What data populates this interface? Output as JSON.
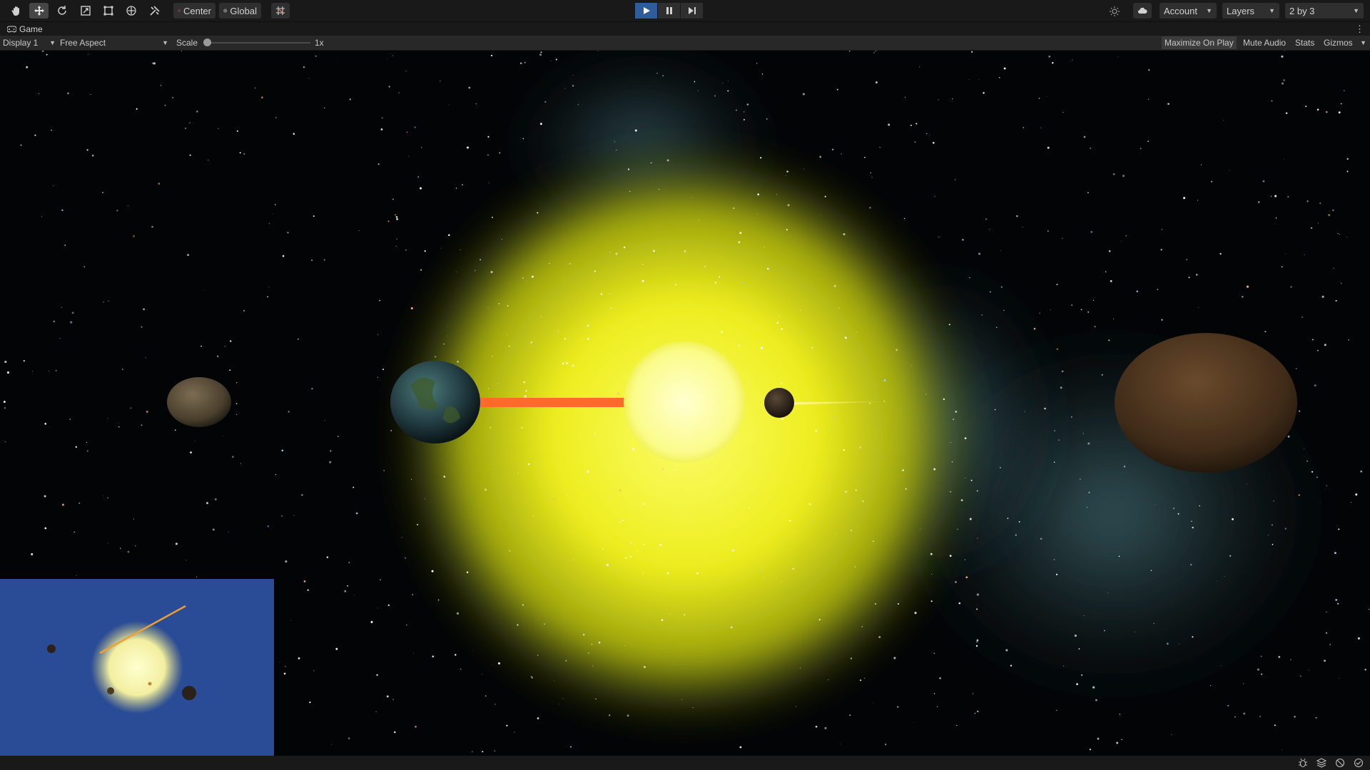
{
  "toolbar": {
    "pivot_label": "Center",
    "space_label": "Global",
    "account_label": "Account",
    "layers_label": "Layers",
    "layout_label": "2 by 3"
  },
  "tab": {
    "title": "Game"
  },
  "game_bar": {
    "display_label": "Display 1",
    "aspect_label": "Free Aspect",
    "scale_label": "Scale",
    "scale_value": "1x",
    "scale_fraction": 0.0,
    "maximize_label": "Maximize On Play",
    "mute_label": "Mute Audio",
    "stats_label": "Stats",
    "gizmos_label": "Gizmos"
  },
  "colors": {
    "play_active": "#2f5d9c",
    "sun_glow": "#f2f21e",
    "laser": "#ff6a2a",
    "minimap_bg": "#2a4c96"
  },
  "icons": [
    "hand-icon",
    "move-icon",
    "rotate-icon",
    "scale-icon",
    "rect-icon",
    "transform-icon",
    "custom-tool-icon",
    "grid-snap-icon",
    "play-icon",
    "pause-icon",
    "step-icon",
    "lighting-icon",
    "cloud-icon",
    "gamepad-icon"
  ]
}
